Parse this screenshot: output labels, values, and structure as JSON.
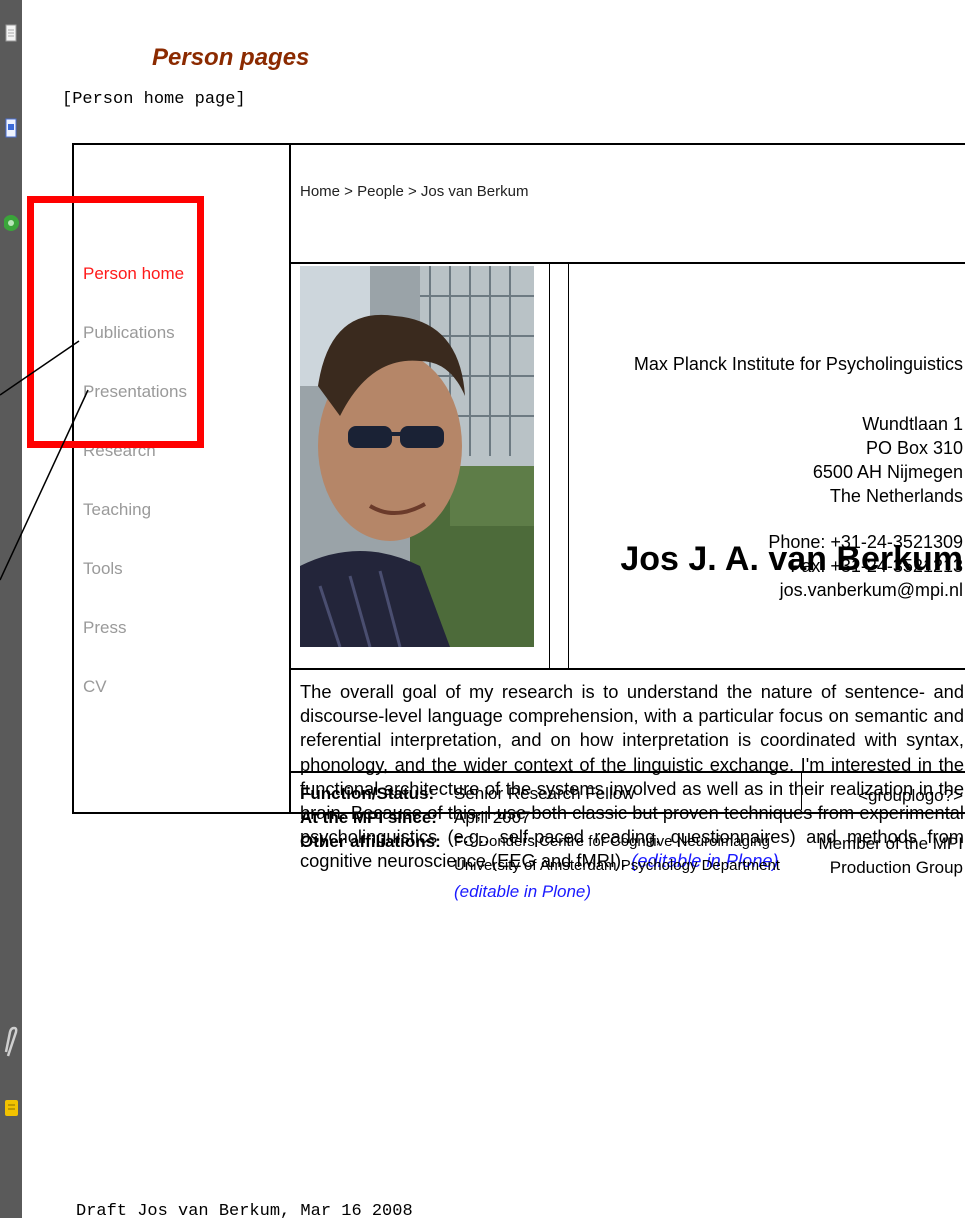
{
  "page": {
    "title": "Person pages",
    "subtitle": "[Person home page]"
  },
  "nav": {
    "items": [
      {
        "label": "Person home",
        "active": true
      },
      {
        "label": "Publications"
      },
      {
        "label": "Presentations"
      },
      {
        "label": "Research"
      },
      {
        "label": "Teaching"
      },
      {
        "label": "Tools"
      },
      {
        "label": "Press"
      },
      {
        "label": "CV"
      }
    ]
  },
  "breadcrumb": "Home > People > Jos van Berkum",
  "person": {
    "name": "Jos J. A. van Berkum",
    "institute": "Max Planck Institute for Psycholinguistics",
    "address": [
      "Wundtlaan 1",
      "PO Box 310",
      "6500 AH Nijmegen",
      "The Netherlands"
    ],
    "phone": "Phone: +31-24-3521309",
    "fax": "Fax: +31-24-3521213",
    "email": "jos.vanberkum@mpi.nl"
  },
  "bio": {
    "text": "The overall goal of my research is to understand the nature of sentence- and discourse-level language comprehension, with a particular focus on semantic and referential interpretation, and on how interpretation is coordinated with syntax, phonology, and the wider context of the linguistic exchange. I'm interested in the functional architecture of the systems involved as well as in their realization in the brain. Because of this, I use both classic but proven techniques from experimental psycholinguistics (e.g., self-paced reading, questionnaires) and methods from cognitive neuroscience (EEG and fMRI).",
    "edit_link": "(editable in Plone)"
  },
  "details": {
    "function_label": "Function/Status:",
    "function_value": "Senior Research Fellow",
    "since_label": "At the MPI since:",
    "since_value": "April 2007",
    "affil_label": "Other affiliations:",
    "affil_1": "FC Donders Centre for Cognitive Neuroimaging",
    "affil_2": "University of Amsterdam Psychology Department",
    "edit_link": "(editable in Plone)"
  },
  "group": {
    "logo_placeholder": "<grouplogo?>",
    "line1": "Member of the MPI",
    "line2": "Production Group"
  },
  "footer": "Draft Jos van Berkum, Mar 16 2008",
  "colors": {
    "title": "#8b2a00",
    "active_nav": "#ff1a1a",
    "nav": "#9a9a9a",
    "link": "#1a1aff",
    "annotation": "#ff0000"
  },
  "sidebar_icons": [
    "document-icon",
    "page-icon",
    "green-circle-icon",
    "paperclip-icon",
    "note-icon"
  ]
}
